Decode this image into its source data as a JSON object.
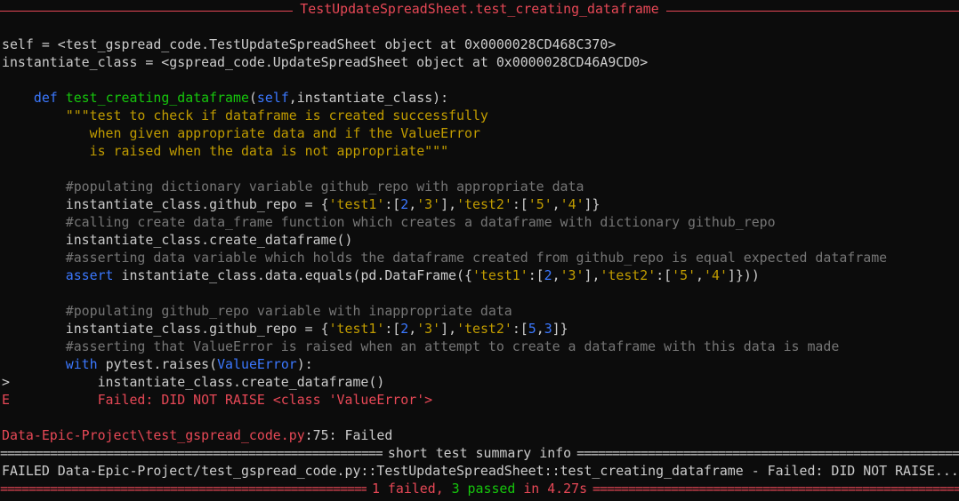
{
  "window": {
    "header_title": "TestUpdateSpreadSheet.test_creating_dataframe"
  },
  "context": {
    "self_line": "self = <test_gspread_code.TestUpdateSpreadSheet object at 0x0000028CD468C370>",
    "instantiate_line": "instantiate_class = <gspread_code.UpdateSpreadSheet object at 0x0000028CD46A9CD0>"
  },
  "code": {
    "def_kw": "def",
    "func_name": "test_creating_dataframe",
    "sig_paren_open": "(",
    "sig_self": "self",
    "sig_rest": ",instantiate_class):",
    "doc1": "\"\"\"test to check if dataframe is created successfully",
    "doc2": "   when given appropriate data and if the ValueError",
    "doc3": "   is raised when the data is not appropriate\"\"\"",
    "cm1": "#populating dictionary variable github_repo with appropriate data",
    "l1_a": "instantiate_class.github_repo = {",
    "l1_s1": "'test1'",
    "l1_b": ":[",
    "l1_n1": "2",
    "l1_c": ",",
    "l1_s2": "'3'",
    "l1_d": "],",
    "l1_s3": "'test2'",
    "l1_e": ":[",
    "l1_s4": "'5'",
    "l1_f": ",",
    "l1_s5": "'4'",
    "l1_g": "]}",
    "cm2": "#calling create data_frame function which creates a dataframe with dictionary github_repo",
    "l2": "instantiate_class.create_dataframe()",
    "cm3": "#asserting data variable which holds the dataframe created from github_repo is equal expected dataframe",
    "assert_kw": "assert",
    "l3_a": " instantiate_class.data.equals(pd.DataFrame({",
    "l3_s1": "'test1'",
    "l3_b": ":[",
    "l3_n1": "2",
    "l3_c": ",",
    "l3_s2": "'3'",
    "l3_d": "],",
    "l3_s3": "'test2'",
    "l3_e": ":[",
    "l3_s4": "'5'",
    "l3_f": ",",
    "l3_s5": "'4'",
    "l3_g": "]}))",
    "cm4": "#populating github_repo variable with inappropriate data",
    "l4_a": "instantiate_class.github_repo = {",
    "l4_s1": "'test1'",
    "l4_b": ":[",
    "l4_n1": "2",
    "l4_c": ",",
    "l4_s2": "'3'",
    "l4_d": "],",
    "l4_s3": "'test2'",
    "l4_e": ":[",
    "l4_n2": "5",
    "l4_f": ",",
    "l4_n3": "3",
    "l4_g": "]}",
    "cm5": "#asserting that ValueError is raised when an attempt to create a dataframe with this data is made",
    "with_kw": "with",
    "l5_a": " pytest.raises(",
    "l5_err": "ValueError",
    "l5_b": "):",
    "arrow": ">",
    "l6": "instantiate_class.create_dataframe()",
    "e_mark": "E",
    "err_msg": "Failed: DID NOT RAISE <class 'ValueError'>"
  },
  "location": {
    "path": "Data-Epic-Project\\test_gspread_code.py",
    "suffix": ":75: Failed"
  },
  "summary": {
    "header": "short test summary info",
    "failed_line": "FAILED Data-Epic-Project/test_gspread_code.py::TestUpdateSpreadSheet::test_creating_dataframe - Failed: DID NOT RAISE...",
    "failed_count": "1 failed",
    "sep": ", ",
    "passed_count": "3 passed",
    "time": " in 4.27s"
  },
  "colors": {
    "background": "#0c0c0c",
    "text": "#cccccc",
    "red": "#e74856",
    "green": "#16c60c",
    "blue": "#3b78ff",
    "yellow": "#c19c00",
    "comment": "#767676"
  }
}
